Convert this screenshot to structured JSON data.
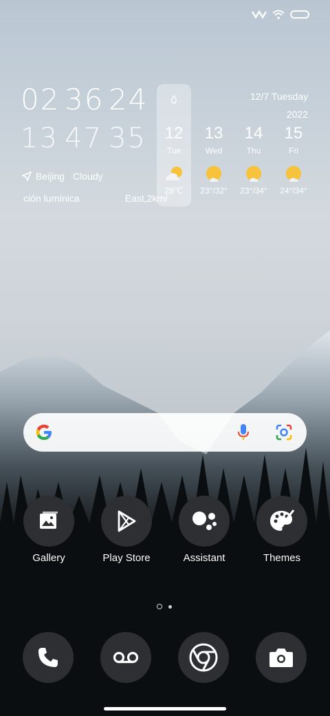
{
  "clock": {
    "row1": [
      "02",
      "36",
      "24"
    ],
    "row2": [
      "13",
      "47",
      "35"
    ]
  },
  "weather": {
    "location": "Beijing",
    "condition": "Cloudy",
    "line2_left": "ción lumínica",
    "line2_right": "East,2km/"
  },
  "date": {
    "line1": "12/7 Tuesday",
    "line2": "2022"
  },
  "forecast": [
    {
      "day": "12",
      "dow": "Tue",
      "temp": "28℃"
    },
    {
      "day": "13",
      "dow": "Wed",
      "temp": "23°/32°"
    },
    {
      "day": "14",
      "dow": "Thu",
      "temp": "23°/34°"
    },
    {
      "day": "15",
      "dow": "Fri",
      "temp": "24°/34°"
    }
  ],
  "apps": [
    {
      "label": "Gallery"
    },
    {
      "label": "Play Store"
    },
    {
      "label": "Assistant"
    },
    {
      "label": "Themes"
    }
  ],
  "colors": {
    "icon_bg": "#2d2f33",
    "sun": "#f7c23c"
  }
}
